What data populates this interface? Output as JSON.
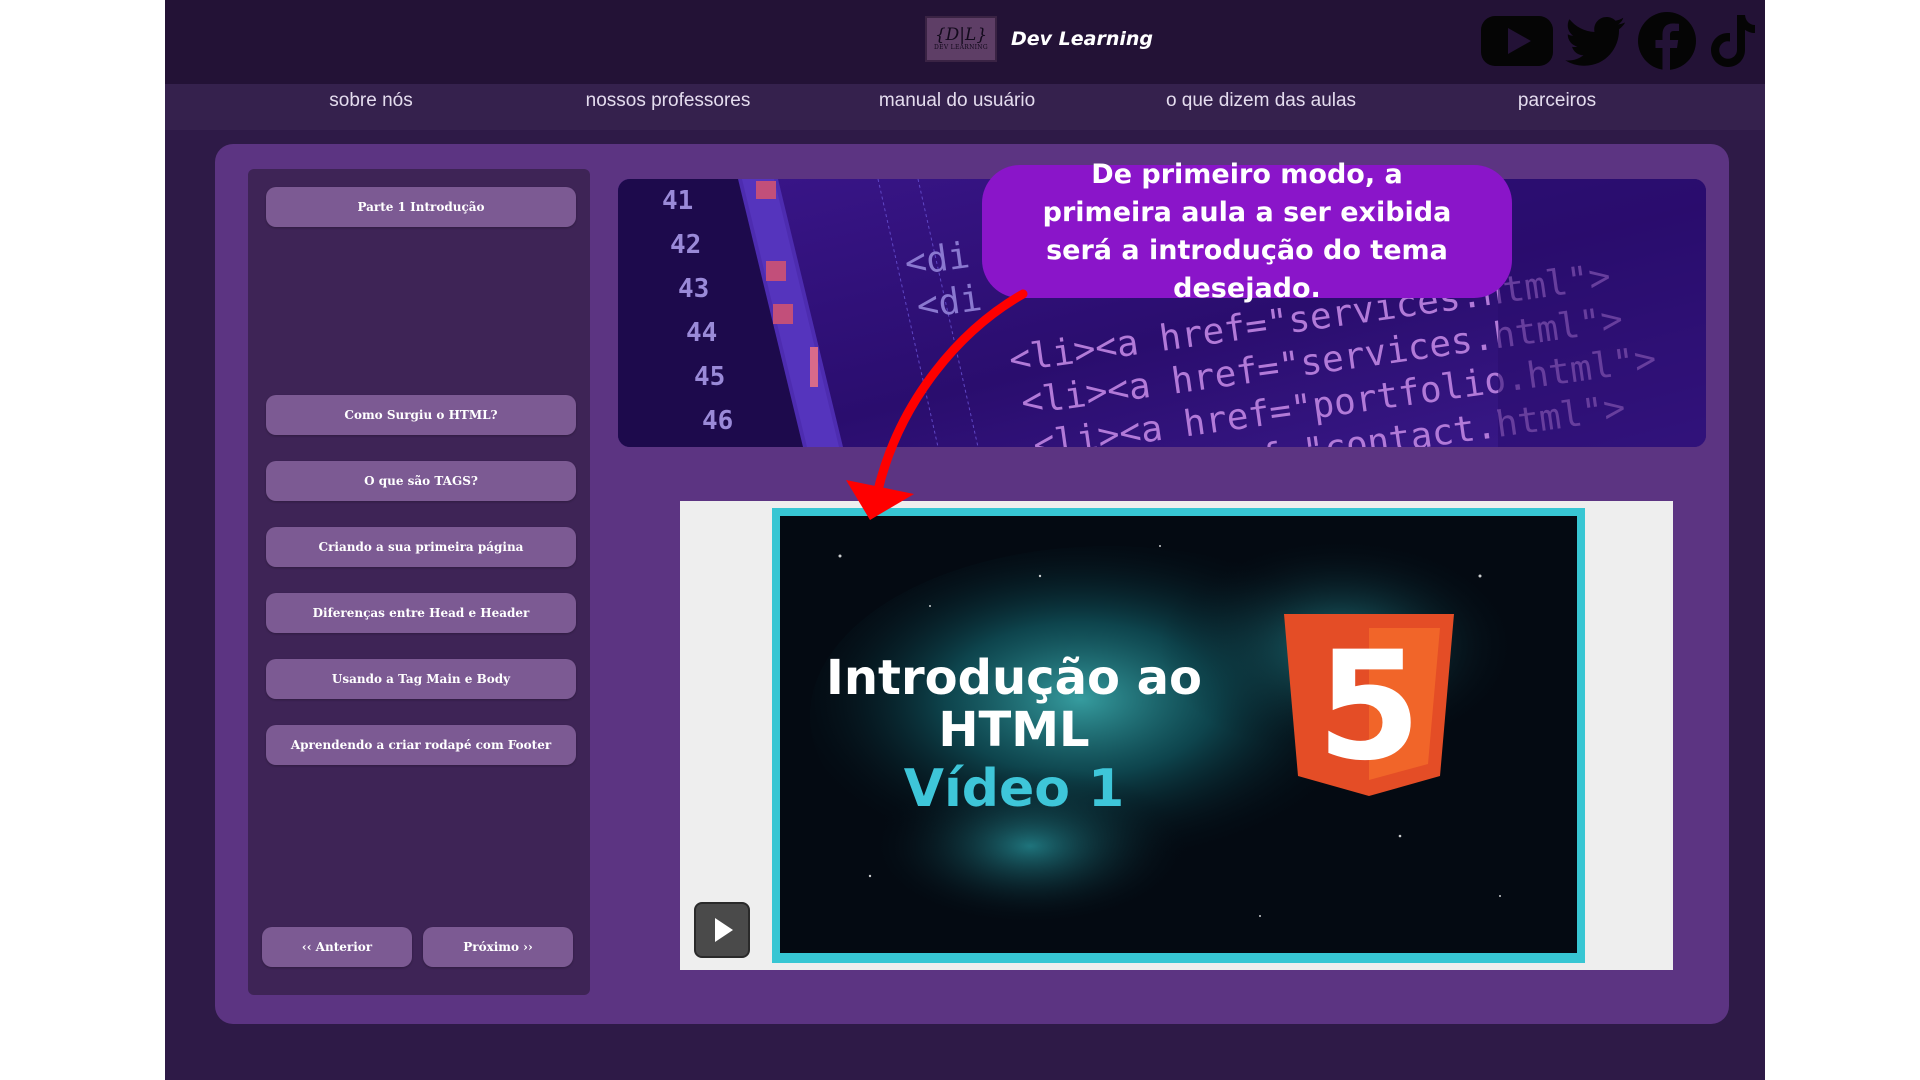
{
  "brand": {
    "logo_main": "{D|L}",
    "logo_sub": "DEV LEARNING",
    "name": "Dev Learning"
  },
  "socials": [
    {
      "icon": "youtube-icon"
    },
    {
      "icon": "twitter-icon"
    },
    {
      "icon": "facebook-icon"
    },
    {
      "icon": "tiktok-icon"
    }
  ],
  "nav": {
    "items": [
      {
        "label": "sobre nós"
      },
      {
        "label": "nossos professores"
      },
      {
        "label": "manual do usuário"
      },
      {
        "label": "o que dizem das aulas"
      },
      {
        "label": "parceiros"
      }
    ]
  },
  "sidebar": {
    "lessons": [
      {
        "label": "Parte 1  Introdução"
      },
      {
        "label": "Como Surgiu o HTML?"
      },
      {
        "label": "O que são TAGS?"
      },
      {
        "label": "Criando a sua primeira página"
      },
      {
        "label": "Diferenças entre Head e Header"
      },
      {
        "label": "Usando a Tag Main e Body"
      },
      {
        "label": "Aprendendo a criar rodapé com Footer"
      }
    ],
    "prev_label": "‹‹ Anterior",
    "next_label": "Próximo ››"
  },
  "banner": {
    "line_numbers": [
      "41",
      "42",
      "43",
      "44",
      "45",
      "46"
    ],
    "code_lines": [
      "<di",
      "<di",
      "<li><a href=\"services.html\">",
      "<li><a href=\"services.html\">",
      "<li><a href=\"portfolio.html\">",
      "<li><a href=\"contact.html\">"
    ]
  },
  "video": {
    "title_line1": "Introdução ao",
    "title_line2": "HTML",
    "title_line3": "Vídeo 1",
    "badge_text": "5",
    "colors": {
      "frame": "#37c6d3",
      "badge": "#e44d26",
      "subtitle": "#3ec6d9"
    }
  },
  "callout": {
    "text": "De primeiro modo, a primeira aula a ser exibida será a introdução do tema desejado."
  },
  "colors": {
    "page_bg": "#2e1a47",
    "panel": "#5c3482",
    "sidebar": "#3e2456",
    "button": "#7c5a93",
    "callout": "#8a15c9",
    "arrow": "#ff0000"
  }
}
